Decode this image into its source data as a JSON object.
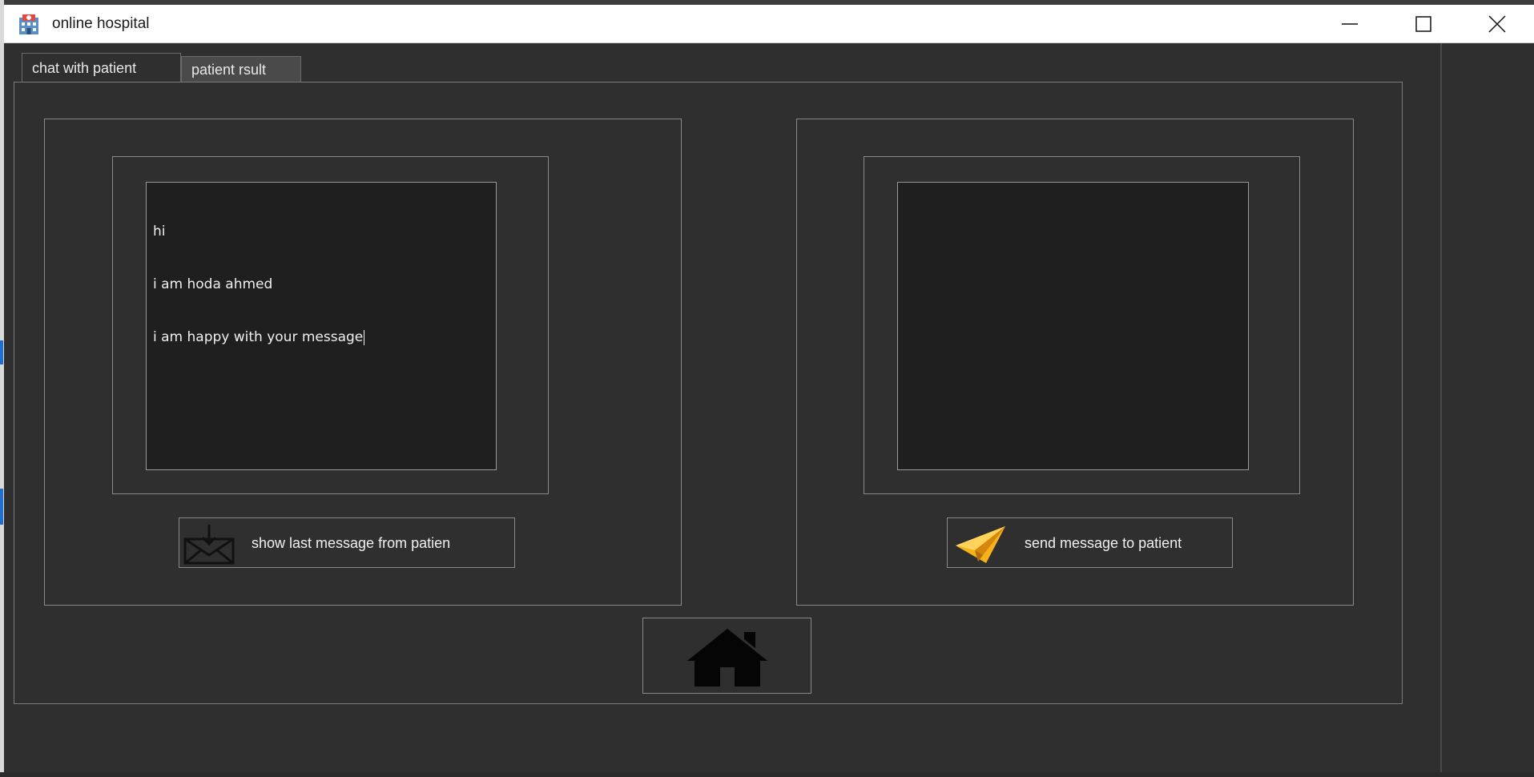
{
  "window": {
    "title": "online hospital",
    "app_icon": "hospital-icon",
    "controls": [
      "minimize-icon",
      "maximize-icon",
      "close-icon"
    ]
  },
  "tabs": [
    {
      "label": "chat with patient",
      "active": true
    },
    {
      "label": "patient rsult",
      "active": false
    }
  ],
  "received_panel": {
    "text_lines": [
      "hi",
      "i am hoda ahmed",
      "i am happy with your message"
    ],
    "button_label": "show last message from patien",
    "button_icon": "envelope-download-icon"
  },
  "send_panel": {
    "text_lines": [],
    "button_label": "send message to patient",
    "button_icon": "paper-plane-icon"
  },
  "home_button": {
    "icon": "home-icon"
  },
  "colors": {
    "background": "#2f2f2f",
    "textarea": "#1f1f1f",
    "border": "#8a8a8a",
    "plane": "#f5b21a"
  }
}
